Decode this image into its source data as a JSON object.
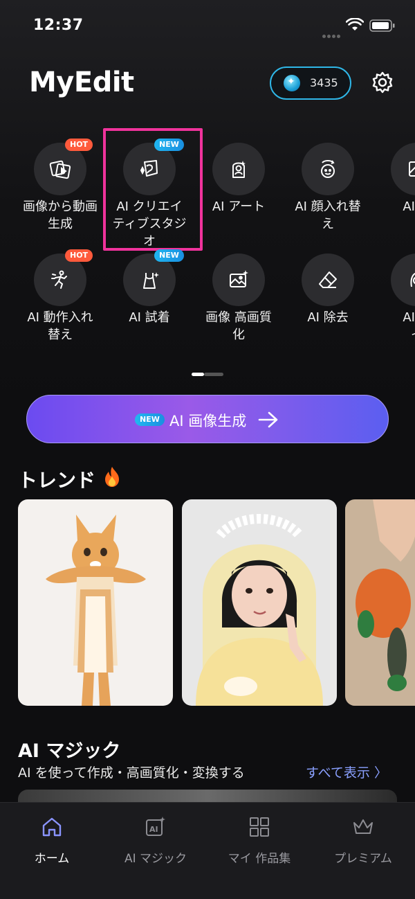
{
  "status_bar": {
    "time": "12:37"
  },
  "header": {
    "app_title": "MyEdit",
    "credits": "3435",
    "settings_icon": "gear-icon"
  },
  "tools": {
    "row1": [
      {
        "label": "画像から動画\n生成",
        "badge": "HOT",
        "icon": "image-to-video-icon"
      },
      {
        "label": "AI クリエイ\nティブスタジ\nオ",
        "badge": "NEW",
        "icon": "creative-studio-icon"
      },
      {
        "label": "AI アート",
        "badge": "",
        "icon": "art-icon"
      },
      {
        "label": "AI 顔入れ替\nえ",
        "badge": "",
        "icon": "face-swap-icon"
      },
      {
        "label": "AI 置",
        "badge": "",
        "icon": "replace-icon"
      }
    ],
    "row2": [
      {
        "label": "AI 動作入れ\n替え",
        "badge": "HOT",
        "icon": "motion-swap-icon"
      },
      {
        "label": "AI 試着",
        "badge": "NEW",
        "icon": "try-on-icon"
      },
      {
        "label": "画像 高画質\n化",
        "badge": "",
        "icon": "enhance-icon"
      },
      {
        "label": "AI 除去",
        "badge": "",
        "icon": "eraser-icon"
      },
      {
        "label": "AI ヘ\nイ",
        "badge": "",
        "icon": "hair-icon"
      }
    ]
  },
  "generate_banner": {
    "badge": "NEW",
    "label": "AI 画像生成"
  },
  "trend": {
    "title": "トレンド"
  },
  "ai_magic": {
    "title": "AI マジック",
    "subtitle": "AI を使って作成・高画質化・変換する",
    "see_all": "すべて表示 〉"
  },
  "bottom_nav": [
    {
      "label": "ホーム",
      "icon": "home-icon",
      "active": true
    },
    {
      "label": "AI マジック",
      "icon": "ai-magic-icon",
      "active": false
    },
    {
      "label": "マイ 作品集",
      "icon": "grid-icon",
      "active": false
    },
    {
      "label": "プレミアム",
      "icon": "crown-icon",
      "active": false
    }
  ],
  "colors": {
    "accent_blue": "#2fb7e8",
    "highlight_pink": "#f0339c",
    "hot": "#ff5a3c",
    "link": "#8aa0ff"
  }
}
